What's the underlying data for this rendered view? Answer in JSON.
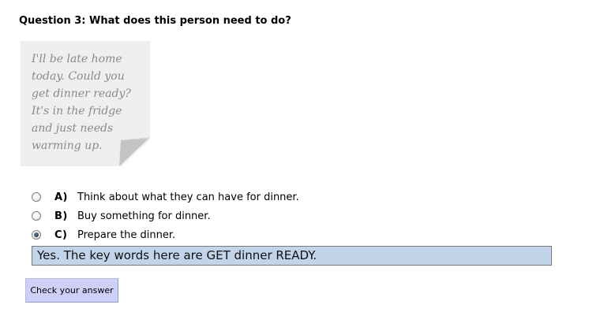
{
  "question": {
    "title": "Question 3: What does this person need to do?"
  },
  "note": {
    "text": "I'll be late home\ntoday. Could you\nget dinner ready?\nIt's in the fridge\nand just needs\nwarming up."
  },
  "options": [
    {
      "letter": "A)",
      "text": "Think about what they can have for dinner.",
      "selected": false
    },
    {
      "letter": "B)",
      "text": "Buy something for dinner.",
      "selected": false
    },
    {
      "letter": "C)",
      "text": "Prepare the dinner.",
      "selected": true
    }
  ],
  "feedback": {
    "text": "Yes. The key words here are GET dinner READY.",
    "background_color": "#c1d4ea"
  },
  "check_button": {
    "label": "Check your answer",
    "background_color": "#cfd0fa"
  }
}
